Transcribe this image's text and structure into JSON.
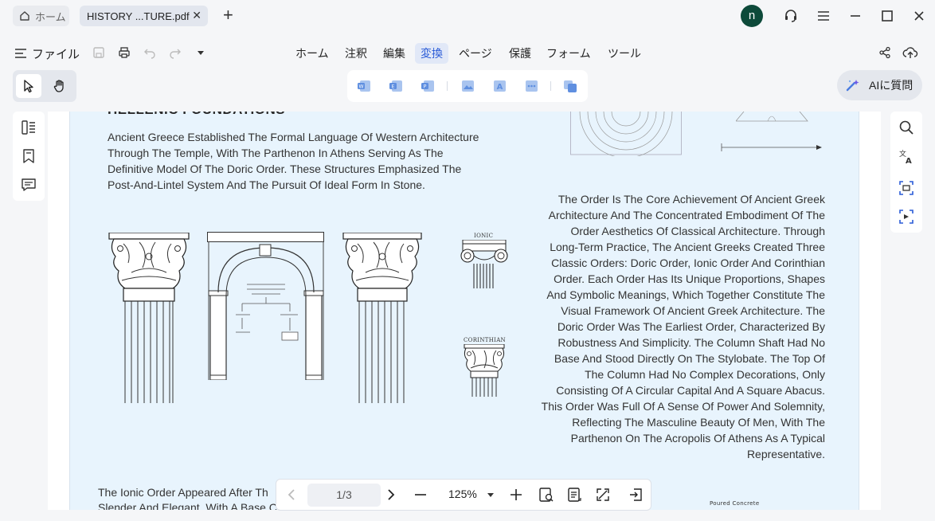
{
  "tabs": {
    "home_label": "ホーム",
    "doc_label": "HISTORY ...TURE.pdf"
  },
  "user": {
    "avatar_initial": "n"
  },
  "menu": {
    "file_label": "ファイル",
    "items": [
      "ホーム",
      "注釈",
      "編集",
      "変換",
      "ページ",
      "保護",
      "フォーム",
      "ツール"
    ],
    "active_item": "変換"
  },
  "ai": {
    "label": "AIに質問"
  },
  "document": {
    "heading": "HELLENIC FOUNDATIONS",
    "para_left": "Ancient Greece Established The Formal Language Of Western Architecture Through The Temple, With The Parthenon In Athens Serving As The Definitive Model Of The Doric Order. These Structures Emphasized The Post-And-Lintel System And The Pursuit Of Ideal Form In Stone.",
    "para_right": "The Order Is The Core Achievement Of Ancient Greek Architecture And The Concentrated Embodiment Of The Order Aesthetics Of Classical Architecture. Through Long-Term Practice, The Ancient Greeks Created Three Classic Orders: Doric Order, Ionic Order And Corinthian Order. Each Order Has Its Unique Proportions, Shapes And Symbolic Meanings, Which Together Constitute The Visual Framework Of Ancient Greek Architecture. The Doric Order Was The Earliest Order, Characterized By Robustness And Simplicity. The Column Shaft Had No Base And Stood Directly On The Stylobate. The Top Of The Column Had No Complex Decorations, Only Consisting Of A Circular Capital And A Square Abacus. This Order Was Full Of A Sense Of Power And Solemnity, Reflecting The Masculine Beauty Of Men, With The Parthenon On The Acropolis Of Athens As A Typical Representative.",
    "para_bottom_line1": "The Ionic Order Appeared After Th",
    "para_bottom_line2": "Slender And Elegant. With A Base C",
    "label_ionic": "IONIC",
    "label_corinthian": "CORINTHIAN",
    "label_poured": "Poured Concrete"
  },
  "pagination": {
    "page_value": "1/3",
    "zoom": "125%"
  }
}
